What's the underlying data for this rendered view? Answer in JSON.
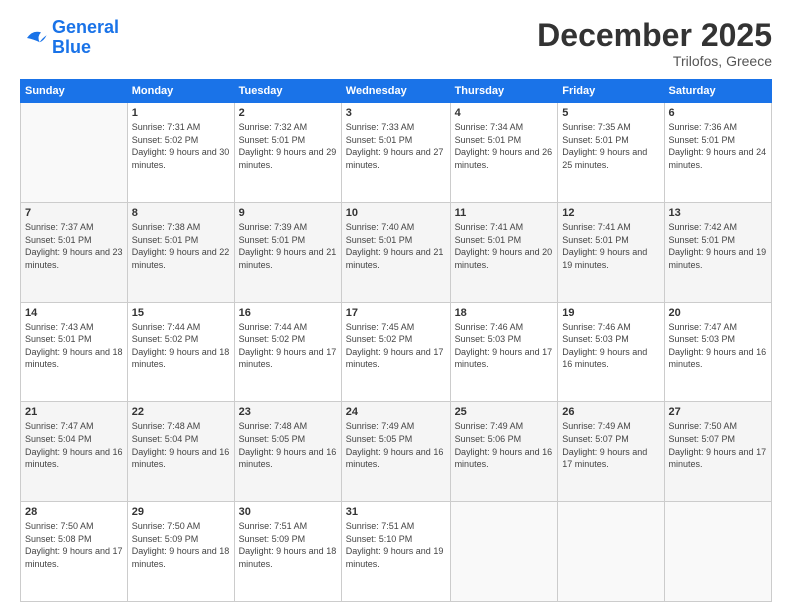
{
  "logo": {
    "line1": "General",
    "line2": "Blue"
  },
  "title": "December 2025",
  "location": "Trilofos, Greece",
  "days_header": [
    "Sunday",
    "Monday",
    "Tuesday",
    "Wednesday",
    "Thursday",
    "Friday",
    "Saturday"
  ],
  "weeks": [
    [
      {
        "num": "",
        "sunrise": "",
        "sunset": "",
        "daylight": ""
      },
      {
        "num": "1",
        "sunrise": "Sunrise: 7:31 AM",
        "sunset": "Sunset: 5:02 PM",
        "daylight": "Daylight: 9 hours and 30 minutes."
      },
      {
        "num": "2",
        "sunrise": "Sunrise: 7:32 AM",
        "sunset": "Sunset: 5:01 PM",
        "daylight": "Daylight: 9 hours and 29 minutes."
      },
      {
        "num": "3",
        "sunrise": "Sunrise: 7:33 AM",
        "sunset": "Sunset: 5:01 PM",
        "daylight": "Daylight: 9 hours and 27 minutes."
      },
      {
        "num": "4",
        "sunrise": "Sunrise: 7:34 AM",
        "sunset": "Sunset: 5:01 PM",
        "daylight": "Daylight: 9 hours and 26 minutes."
      },
      {
        "num": "5",
        "sunrise": "Sunrise: 7:35 AM",
        "sunset": "Sunset: 5:01 PM",
        "daylight": "Daylight: 9 hours and 25 minutes."
      },
      {
        "num": "6",
        "sunrise": "Sunrise: 7:36 AM",
        "sunset": "Sunset: 5:01 PM",
        "daylight": "Daylight: 9 hours and 24 minutes."
      }
    ],
    [
      {
        "num": "7",
        "sunrise": "Sunrise: 7:37 AM",
        "sunset": "Sunset: 5:01 PM",
        "daylight": "Daylight: 9 hours and 23 minutes."
      },
      {
        "num": "8",
        "sunrise": "Sunrise: 7:38 AM",
        "sunset": "Sunset: 5:01 PM",
        "daylight": "Daylight: 9 hours and 22 minutes."
      },
      {
        "num": "9",
        "sunrise": "Sunrise: 7:39 AM",
        "sunset": "Sunset: 5:01 PM",
        "daylight": "Daylight: 9 hours and 21 minutes."
      },
      {
        "num": "10",
        "sunrise": "Sunrise: 7:40 AM",
        "sunset": "Sunset: 5:01 PM",
        "daylight": "Daylight: 9 hours and 21 minutes."
      },
      {
        "num": "11",
        "sunrise": "Sunrise: 7:41 AM",
        "sunset": "Sunset: 5:01 PM",
        "daylight": "Daylight: 9 hours and 20 minutes."
      },
      {
        "num": "12",
        "sunrise": "Sunrise: 7:41 AM",
        "sunset": "Sunset: 5:01 PM",
        "daylight": "Daylight: 9 hours and 19 minutes."
      },
      {
        "num": "13",
        "sunrise": "Sunrise: 7:42 AM",
        "sunset": "Sunset: 5:01 PM",
        "daylight": "Daylight: 9 hours and 19 minutes."
      }
    ],
    [
      {
        "num": "14",
        "sunrise": "Sunrise: 7:43 AM",
        "sunset": "Sunset: 5:01 PM",
        "daylight": "Daylight: 9 hours and 18 minutes."
      },
      {
        "num": "15",
        "sunrise": "Sunrise: 7:44 AM",
        "sunset": "Sunset: 5:02 PM",
        "daylight": "Daylight: 9 hours and 18 minutes."
      },
      {
        "num": "16",
        "sunrise": "Sunrise: 7:44 AM",
        "sunset": "Sunset: 5:02 PM",
        "daylight": "Daylight: 9 hours and 17 minutes."
      },
      {
        "num": "17",
        "sunrise": "Sunrise: 7:45 AM",
        "sunset": "Sunset: 5:02 PM",
        "daylight": "Daylight: 9 hours and 17 minutes."
      },
      {
        "num": "18",
        "sunrise": "Sunrise: 7:46 AM",
        "sunset": "Sunset: 5:03 PM",
        "daylight": "Daylight: 9 hours and 17 minutes."
      },
      {
        "num": "19",
        "sunrise": "Sunrise: 7:46 AM",
        "sunset": "Sunset: 5:03 PM",
        "daylight": "Daylight: 9 hours and 16 minutes."
      },
      {
        "num": "20",
        "sunrise": "Sunrise: 7:47 AM",
        "sunset": "Sunset: 5:03 PM",
        "daylight": "Daylight: 9 hours and 16 minutes."
      }
    ],
    [
      {
        "num": "21",
        "sunrise": "Sunrise: 7:47 AM",
        "sunset": "Sunset: 5:04 PM",
        "daylight": "Daylight: 9 hours and 16 minutes."
      },
      {
        "num": "22",
        "sunrise": "Sunrise: 7:48 AM",
        "sunset": "Sunset: 5:04 PM",
        "daylight": "Daylight: 9 hours and 16 minutes."
      },
      {
        "num": "23",
        "sunrise": "Sunrise: 7:48 AM",
        "sunset": "Sunset: 5:05 PM",
        "daylight": "Daylight: 9 hours and 16 minutes."
      },
      {
        "num": "24",
        "sunrise": "Sunrise: 7:49 AM",
        "sunset": "Sunset: 5:05 PM",
        "daylight": "Daylight: 9 hours and 16 minutes."
      },
      {
        "num": "25",
        "sunrise": "Sunrise: 7:49 AM",
        "sunset": "Sunset: 5:06 PM",
        "daylight": "Daylight: 9 hours and 16 minutes."
      },
      {
        "num": "26",
        "sunrise": "Sunrise: 7:49 AM",
        "sunset": "Sunset: 5:07 PM",
        "daylight": "Daylight: 9 hours and 17 minutes."
      },
      {
        "num": "27",
        "sunrise": "Sunrise: 7:50 AM",
        "sunset": "Sunset: 5:07 PM",
        "daylight": "Daylight: 9 hours and 17 minutes."
      }
    ],
    [
      {
        "num": "28",
        "sunrise": "Sunrise: 7:50 AM",
        "sunset": "Sunset: 5:08 PM",
        "daylight": "Daylight: 9 hours and 17 minutes."
      },
      {
        "num": "29",
        "sunrise": "Sunrise: 7:50 AM",
        "sunset": "Sunset: 5:09 PM",
        "daylight": "Daylight: 9 hours and 18 minutes."
      },
      {
        "num": "30",
        "sunrise": "Sunrise: 7:51 AM",
        "sunset": "Sunset: 5:09 PM",
        "daylight": "Daylight: 9 hours and 18 minutes."
      },
      {
        "num": "31",
        "sunrise": "Sunrise: 7:51 AM",
        "sunset": "Sunset: 5:10 PM",
        "daylight": "Daylight: 9 hours and 19 minutes."
      },
      {
        "num": "",
        "sunrise": "",
        "sunset": "",
        "daylight": ""
      },
      {
        "num": "",
        "sunrise": "",
        "sunset": "",
        "daylight": ""
      },
      {
        "num": "",
        "sunrise": "",
        "sunset": "",
        "daylight": ""
      }
    ]
  ]
}
